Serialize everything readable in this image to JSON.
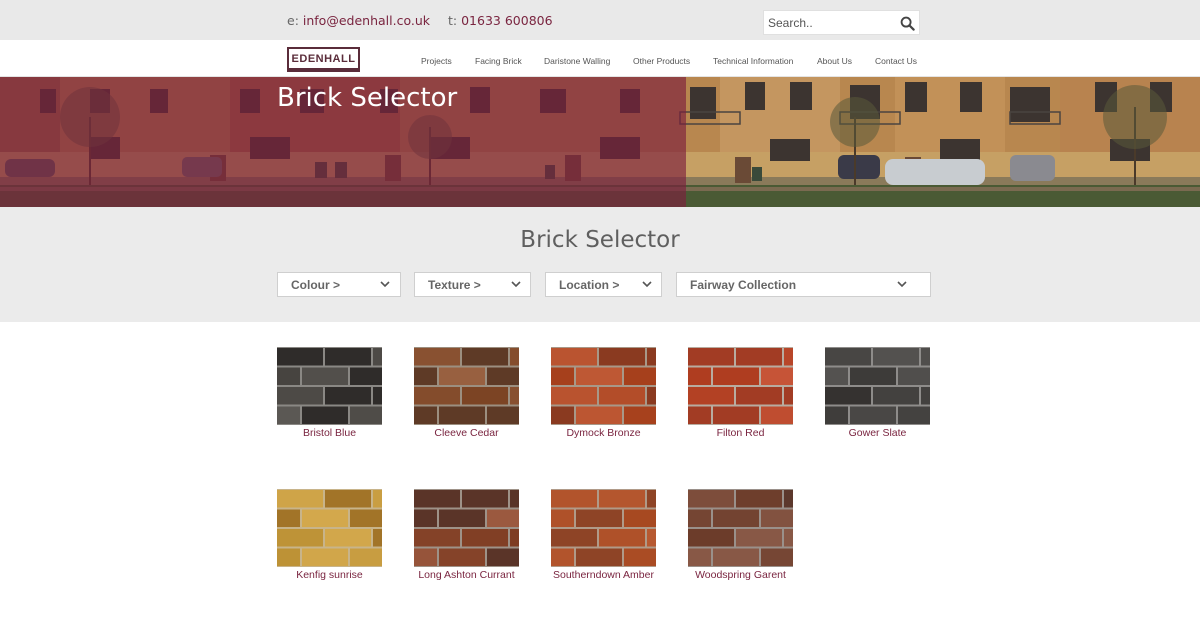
{
  "header": {
    "email_label": "e:",
    "email": "info@edenhall.co.uk",
    "phone_label": "t:",
    "phone": "01633 600806",
    "search_placeholder": "Search..",
    "logo_text": "EDENHALL"
  },
  "nav": {
    "items": [
      {
        "label": "Projects"
      },
      {
        "label": "Facing Brick"
      },
      {
        "label": "Daristone Walling"
      },
      {
        "label": "Other Products"
      },
      {
        "label": "Technical Information"
      },
      {
        "label": "About Us"
      },
      {
        "label": "Contact Us"
      }
    ]
  },
  "banner": {
    "title": "Brick Selector"
  },
  "selector": {
    "title": "Brick Selector",
    "filters": [
      {
        "label": "Colour >"
      },
      {
        "label": "Texture >"
      },
      {
        "label": "Location >"
      },
      {
        "label": "Fairway Collection"
      }
    ]
  },
  "products": [
    {
      "name": "Bristol Blue",
      "base": "#4d4a46",
      "accent": "#2f2c2a",
      "mortar": "#8a8884"
    },
    {
      "name": "Cleeve Cedar",
      "base": "#8a5232",
      "accent": "#5e3a26",
      "mortar": "#9c8f80"
    },
    {
      "name": "Dymock Bronze",
      "base": "#b04a26",
      "accent": "#8a3a20",
      "mortar": "#a89888"
    },
    {
      "name": "Filton Red",
      "base": "#bd4b2e",
      "accent": "#a23c24",
      "mortar": "#b8aca0"
    },
    {
      "name": "Gower Slate",
      "base": "#4a4846",
      "accent": "#353230",
      "mortar": "#8e8c8a"
    },
    {
      "name": "Kenfig sunrise",
      "base": "#c59a3e",
      "accent": "#a27428",
      "mortar": "#c8b48a"
    },
    {
      "name": "Long Ashton Currant",
      "base": "#8c4a30",
      "accent": "#5a3428",
      "mortar": "#9e9288"
    },
    {
      "name": "Southerndown Amber",
      "base": "#b2542c",
      "accent": "#8e4426",
      "mortar": "#b09a88"
    },
    {
      "name": "Woodspring Garent",
      "base": "#7a4a38",
      "accent": "#5c382c",
      "mortar": "#9a908a"
    }
  ],
  "colors": {
    "brand": "#7a2540",
    "banner_overlay": "#7d1f3e"
  }
}
